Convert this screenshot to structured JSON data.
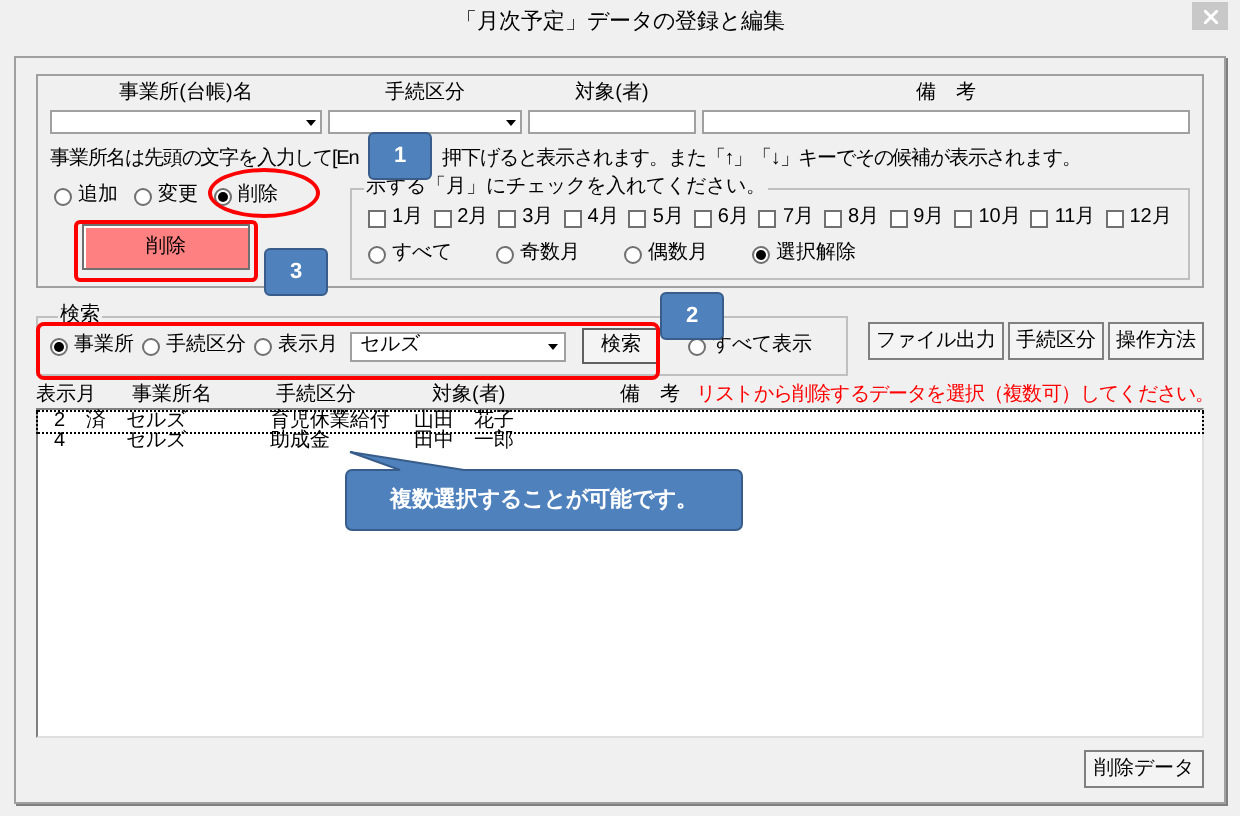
{
  "window": {
    "title": "「月次予定」データの登録と編集"
  },
  "entry": {
    "columns": [
      "事業所(台帳)名",
      "手続区分",
      "対象(者)",
      "備　考"
    ],
    "fields": [
      {
        "kind": "combo"
      },
      {
        "kind": "combo"
      },
      {
        "kind": "text"
      },
      {
        "kind": "text"
      }
    ],
    "hint": [
      "事業所名は先頭の文字を入力して[En",
      "押下げると表示されます。また「↑」「↓」キーでその候補が表示されます。"
    ],
    "modes": [
      {
        "label": "追加",
        "selected": false
      },
      {
        "label": "変更",
        "selected": false
      },
      {
        "label": "削除",
        "selected": true
      }
    ],
    "action_button": "削除"
  },
  "month_group": {
    "label": "示する「月」にチェックを入れてください。",
    "months": [
      {
        "label": "1月",
        "checked": false
      },
      {
        "label": "2月",
        "checked": false
      },
      {
        "label": "3月",
        "checked": false
      },
      {
        "label": "4月",
        "checked": false
      },
      {
        "label": "5月",
        "checked": false
      },
      {
        "label": "6月",
        "checked": false
      },
      {
        "label": "7月",
        "checked": false
      },
      {
        "label": "8月",
        "checked": false
      },
      {
        "label": "9月",
        "checked": false
      },
      {
        "label": "10月",
        "checked": false
      },
      {
        "label": "11月",
        "checked": false
      },
      {
        "label": "12月",
        "checked": false
      }
    ],
    "presets": [
      {
        "label": "すべて",
        "selected": false
      },
      {
        "label": "奇数月",
        "selected": false
      },
      {
        "label": "偶数月",
        "selected": false
      },
      {
        "label": "選択解除",
        "selected": true
      }
    ]
  },
  "search": {
    "label": "検索",
    "options": [
      {
        "label": "事業所",
        "selected": true
      },
      {
        "label": "手続区分",
        "selected": false
      },
      {
        "label": "表示月",
        "selected": false
      }
    ],
    "value": "セルズ",
    "button": "検索",
    "show_all": {
      "label": "すべて表示",
      "selected": false
    }
  },
  "tool_buttons": [
    "ファイル出力",
    "手続区分",
    "操作方法"
  ],
  "list": {
    "columns": [
      "表示月",
      "事業所名",
      "手続区分",
      "対象(者)",
      "備　考"
    ],
    "message": "リストから削除するデータを選択（複数可）してください。",
    "rows": [
      {
        "month": "2",
        "flag": "済",
        "office": "セルズ",
        "procedure": "育児休業給付",
        "person": "山田　花子",
        "focused": true
      },
      {
        "month": "4",
        "office": "セルズ",
        "procedure": "助成金",
        "person": "田中　一郎",
        "focused": false
      }
    ]
  },
  "footer_button": "削除データ",
  "annotations": {
    "badges": [
      "1",
      "2",
      "3"
    ],
    "bubble": "複数選択することが可能です。"
  }
}
